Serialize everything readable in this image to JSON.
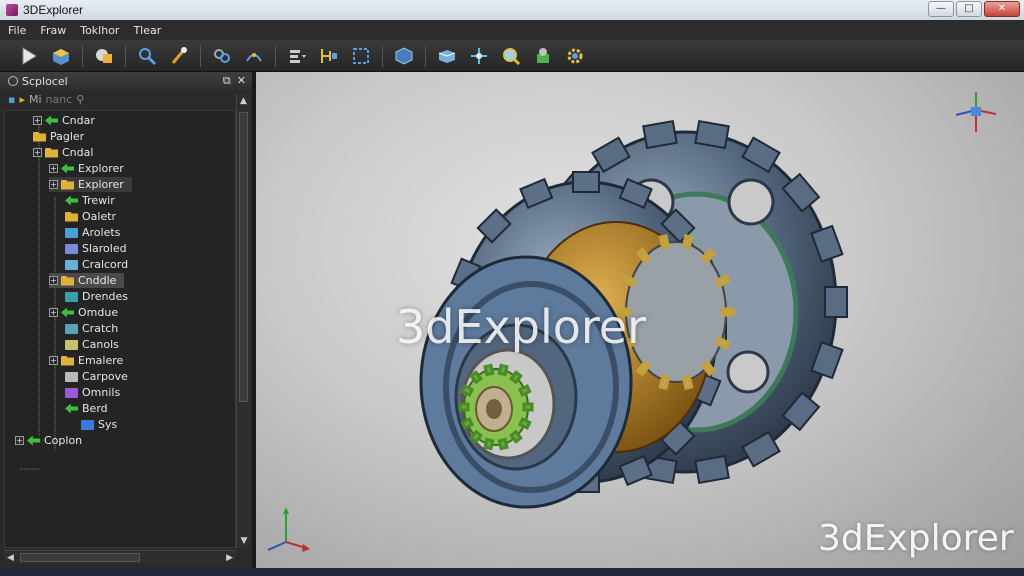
{
  "window": {
    "title": "3DExplorer"
  },
  "menu": [
    "File",
    "Fraw",
    "Toklhor",
    "Tlear"
  ],
  "toolbar_icons": [
    "select-arrow-icon",
    "solid-box-icon",
    "material-icon",
    "zoom-icon",
    "paint-icon",
    "link-icon",
    "connect-icon",
    "list-icon",
    "align-icon",
    "frame-icon",
    "cube-icon",
    "box-icon",
    "axis-icon",
    "search-icon",
    "object-icon",
    "settings-icon"
  ],
  "explorer": {
    "title": "Scplocel",
    "tools_label": "Mi",
    "tools_extra": "nanc",
    "tree": [
      {
        "label": "Cndar",
        "icon": "green-arrow",
        "color": "#3cbf3c"
      },
      {
        "label": "Pagler",
        "icon": "folder",
        "color": "#e0b23a"
      },
      {
        "label": "Cndal",
        "icon": "folder",
        "color": "#e0b23a"
      },
      {
        "label": "Explorer",
        "icon": "green-arrow",
        "color": "#3cbf3c"
      },
      {
        "label": "Explorer",
        "icon": "folder",
        "color": "#e0b23a"
      },
      {
        "label": "Trewir",
        "icon": "green-arrow",
        "color": "#3cbf3c"
      },
      {
        "label": "Oaletr",
        "icon": "folder",
        "color": "#e0b23a"
      },
      {
        "label": "Arolets",
        "icon": "layers",
        "color": "#4aa0d8"
      },
      {
        "label": "Slaroled",
        "icon": "parts",
        "color": "#7a8ad8"
      },
      {
        "label": "Cralcord",
        "icon": "doc",
        "color": "#6ab0d8"
      },
      {
        "label": "Cnddle",
        "icon": "folder",
        "color": "#e0b23a"
      },
      {
        "label": "Drendes",
        "icon": "layers",
        "color": "#3aa0a8"
      },
      {
        "label": "Omdue",
        "icon": "green-arrow",
        "color": "#3cbf3c"
      },
      {
        "label": "Cratch",
        "icon": "parts",
        "color": "#5aa0b8"
      },
      {
        "label": "Canols",
        "icon": "tool",
        "color": "#c8c070"
      },
      {
        "label": "Emalere",
        "icon": "folder",
        "color": "#e0b23a"
      },
      {
        "label": "Carpove",
        "icon": "funnel",
        "color": "#b8b8b8"
      },
      {
        "label": "Omnils",
        "icon": "purple",
        "color": "#9a5ad8"
      },
      {
        "label": "Berd",
        "icon": "green-arrow",
        "color": "#3cbf3c"
      },
      {
        "label": "Sys",
        "icon": "blue-shape",
        "color": "#3a7ad8"
      },
      {
        "label": "Coplon",
        "icon": "green-arrow",
        "color": "#3cbf3c"
      }
    ]
  },
  "viewport": {
    "watermark_center": "3dExplorer",
    "watermark_corner": "3dExplorer"
  }
}
